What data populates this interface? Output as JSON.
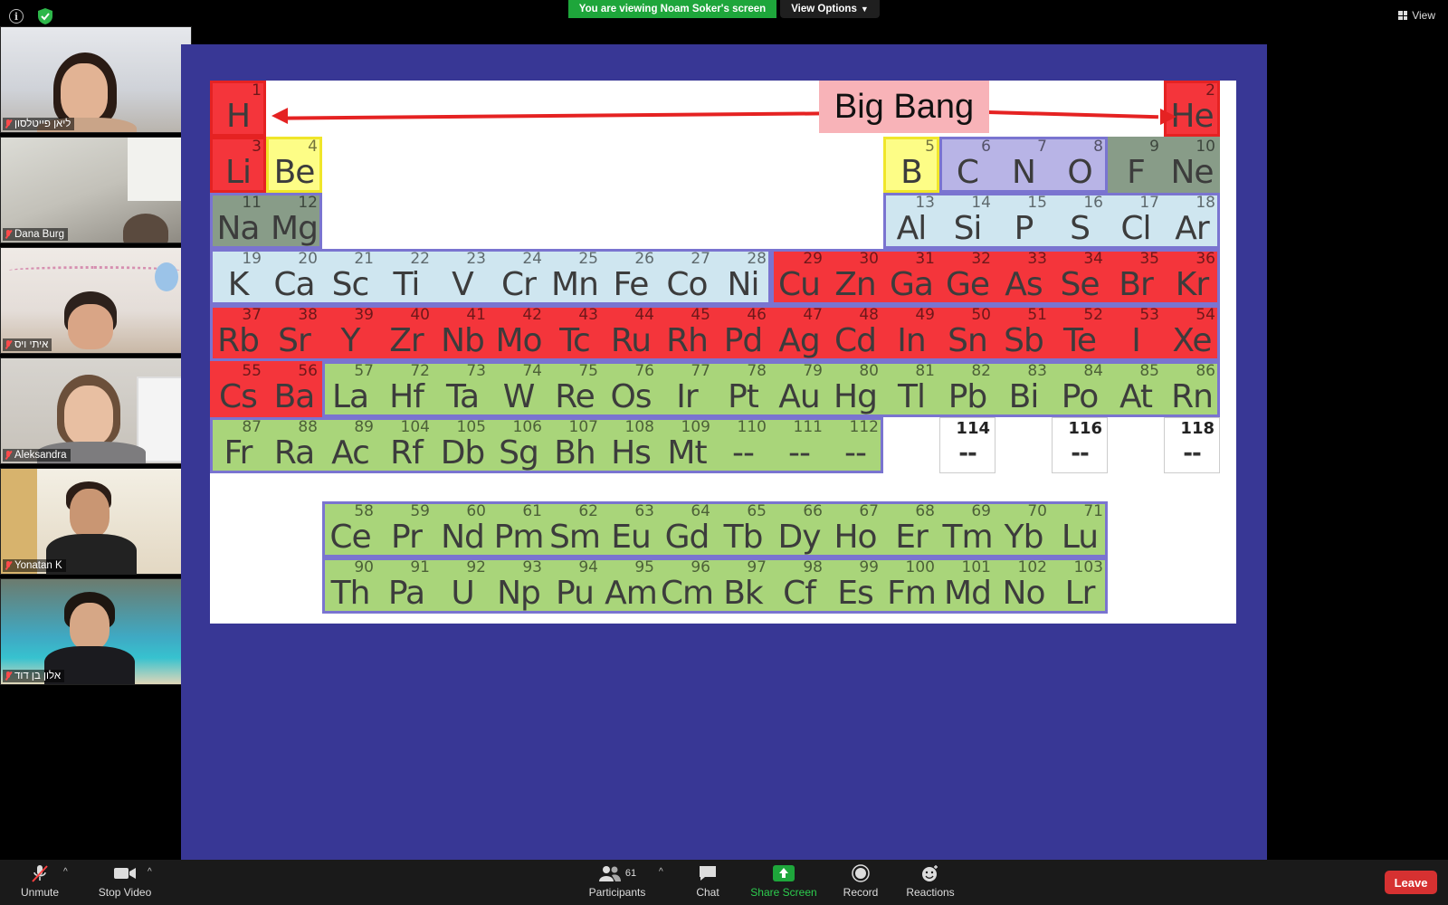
{
  "meeting": {
    "share_banner": "You are viewing Noam Soker's screen",
    "view_options": "View Options",
    "view_label": "View"
  },
  "participants": [
    {
      "name": "ליאן פייטלסון"
    },
    {
      "name": "Dana Burg"
    },
    {
      "name": "איתי ויס"
    },
    {
      "name": "Aleksandra"
    },
    {
      "name": "Yonatan K"
    },
    {
      "name": "אלון בן דוד"
    }
  ],
  "slide": {
    "title": "Big Bang",
    "colors": {
      "red": "#f4353b",
      "green": "#a9d57a",
      "light_blue": "#cfe6f0",
      "purple": "#b8b4e6",
      "gray_green": "#889c88",
      "yellow": "#fdfd86",
      "background": "#383795"
    },
    "elements": [
      {
        "n": "1",
        "s": "H",
        "c": "c-red"
      },
      {
        "n": "2",
        "s": "He",
        "c": "c-red"
      },
      {
        "n": "3",
        "s": "Li",
        "c": "c-red"
      },
      {
        "n": "4",
        "s": "Be",
        "c": "c-yellow"
      },
      {
        "n": "5",
        "s": "B",
        "c": "c-yellow"
      },
      {
        "n": "6",
        "s": "C",
        "c": "c-purple"
      },
      {
        "n": "7",
        "s": "N",
        "c": "c-purple"
      },
      {
        "n": "8",
        "s": "O",
        "c": "c-purple"
      },
      {
        "n": "9",
        "s": "F",
        "c": "c-dark"
      },
      {
        "n": "10",
        "s": "Ne",
        "c": "c-dark"
      },
      {
        "n": "11",
        "s": "Na",
        "c": "c-dark"
      },
      {
        "n": "12",
        "s": "Mg",
        "c": "c-dark"
      },
      {
        "n": "13",
        "s": "Al",
        "c": "c-blue"
      },
      {
        "n": "14",
        "s": "Si",
        "c": "c-blue"
      },
      {
        "n": "15",
        "s": "P",
        "c": "c-blue"
      },
      {
        "n": "16",
        "s": "S",
        "c": "c-blue"
      },
      {
        "n": "17",
        "s": "Cl",
        "c": "c-blue"
      },
      {
        "n": "18",
        "s": "Ar",
        "c": "c-blue"
      },
      {
        "n": "19",
        "s": "K",
        "c": "c-blue"
      },
      {
        "n": "20",
        "s": "Ca",
        "c": "c-blue"
      },
      {
        "n": "21",
        "s": "Sc",
        "c": "c-blue"
      },
      {
        "n": "22",
        "s": "Ti",
        "c": "c-blue"
      },
      {
        "n": "23",
        "s": "V",
        "c": "c-blue"
      },
      {
        "n": "24",
        "s": "Cr",
        "c": "c-blue"
      },
      {
        "n": "25",
        "s": "Mn",
        "c": "c-blue"
      },
      {
        "n": "26",
        "s": "Fe",
        "c": "c-blue"
      },
      {
        "n": "27",
        "s": "Co",
        "c": "c-blue"
      },
      {
        "n": "28",
        "s": "Ni",
        "c": "c-blue"
      },
      {
        "n": "29",
        "s": "Cu",
        "c": "c-red"
      },
      {
        "n": "30",
        "s": "Zn",
        "c": "c-red"
      },
      {
        "n": "31",
        "s": "Ga",
        "c": "c-red"
      },
      {
        "n": "32",
        "s": "Ge",
        "c": "c-red"
      },
      {
        "n": "33",
        "s": "As",
        "c": "c-red"
      },
      {
        "n": "34",
        "s": "Se",
        "c": "c-red"
      },
      {
        "n": "35",
        "s": "Br",
        "c": "c-red"
      },
      {
        "n": "36",
        "s": "Kr",
        "c": "c-red"
      },
      {
        "n": "37",
        "s": "Rb",
        "c": "c-red"
      },
      {
        "n": "38",
        "s": "Sr",
        "c": "c-red"
      },
      {
        "n": "39",
        "s": "Y",
        "c": "c-red"
      },
      {
        "n": "40",
        "s": "Zr",
        "c": "c-red"
      },
      {
        "n": "41",
        "s": "Nb",
        "c": "c-red"
      },
      {
        "n": "42",
        "s": "Mo",
        "c": "c-red"
      },
      {
        "n": "43",
        "s": "Tc",
        "c": "c-red"
      },
      {
        "n": "44",
        "s": "Ru",
        "c": "c-red"
      },
      {
        "n": "45",
        "s": "Rh",
        "c": "c-red"
      },
      {
        "n": "46",
        "s": "Pd",
        "c": "c-red"
      },
      {
        "n": "47",
        "s": "Ag",
        "c": "c-red"
      },
      {
        "n": "48",
        "s": "Cd",
        "c": "c-red"
      },
      {
        "n": "49",
        "s": "In",
        "c": "c-red"
      },
      {
        "n": "50",
        "s": "Sn",
        "c": "c-red"
      },
      {
        "n": "51",
        "s": "Sb",
        "c": "c-red"
      },
      {
        "n": "52",
        "s": "Te",
        "c": "c-red"
      },
      {
        "n": "53",
        "s": "I",
        "c": "c-red"
      },
      {
        "n": "54",
        "s": "Xe",
        "c": "c-red"
      },
      {
        "n": "55",
        "s": "Cs",
        "c": "c-red"
      },
      {
        "n": "56",
        "s": "Ba",
        "c": "c-red"
      },
      {
        "n": "57",
        "s": "La",
        "c": "c-green"
      },
      {
        "n": "72",
        "s": "Hf",
        "c": "c-green"
      },
      {
        "n": "73",
        "s": "Ta",
        "c": "c-green"
      },
      {
        "n": "74",
        "s": "W",
        "c": "c-green"
      },
      {
        "n": "75",
        "s": "Re",
        "c": "c-green"
      },
      {
        "n": "76",
        "s": "Os",
        "c": "c-green"
      },
      {
        "n": "77",
        "s": "Ir",
        "c": "c-green"
      },
      {
        "n": "78",
        "s": "Pt",
        "c": "c-green"
      },
      {
        "n": "79",
        "s": "Au",
        "c": "c-green"
      },
      {
        "n": "80",
        "s": "Hg",
        "c": "c-green"
      },
      {
        "n": "81",
        "s": "Tl",
        "c": "c-green"
      },
      {
        "n": "82",
        "s": "Pb",
        "c": "c-green"
      },
      {
        "n": "83",
        "s": "Bi",
        "c": "c-green"
      },
      {
        "n": "84",
        "s": "Po",
        "c": "c-green"
      },
      {
        "n": "85",
        "s": "At",
        "c": "c-green"
      },
      {
        "n": "86",
        "s": "Rn",
        "c": "c-green"
      },
      {
        "n": "87",
        "s": "Fr",
        "c": "c-green"
      },
      {
        "n": "88",
        "s": "Ra",
        "c": "c-green"
      },
      {
        "n": "89",
        "s": "Ac",
        "c": "c-green"
      },
      {
        "n": "104",
        "s": "Rf",
        "c": "c-green"
      },
      {
        "n": "105",
        "s": "Db",
        "c": "c-green"
      },
      {
        "n": "106",
        "s": "Sg",
        "c": "c-green"
      },
      {
        "n": "107",
        "s": "Bh",
        "c": "c-green"
      },
      {
        "n": "108",
        "s": "Hs",
        "c": "c-green"
      },
      {
        "n": "109",
        "s": "Mt",
        "c": "c-green"
      },
      {
        "n": "110",
        "s": "--",
        "c": "c-green"
      },
      {
        "n": "111",
        "s": "--",
        "c": "c-green"
      },
      {
        "n": "112",
        "s": "--",
        "c": "c-green"
      },
      {
        "n": "114",
        "s": "--",
        "c": "c-white"
      },
      {
        "n": "116",
        "s": "--",
        "c": "c-white"
      },
      {
        "n": "118",
        "s": "--",
        "c": "c-white"
      },
      {
        "n": "58",
        "s": "Ce",
        "c": "c-green"
      },
      {
        "n": "59",
        "s": "Pr",
        "c": "c-green"
      },
      {
        "n": "60",
        "s": "Nd",
        "c": "c-green"
      },
      {
        "n": "61",
        "s": "Pm",
        "c": "c-green"
      },
      {
        "n": "62",
        "s": "Sm",
        "c": "c-green"
      },
      {
        "n": "63",
        "s": "Eu",
        "c": "c-green"
      },
      {
        "n": "64",
        "s": "Gd",
        "c": "c-green"
      },
      {
        "n": "65",
        "s": "Tb",
        "c": "c-green"
      },
      {
        "n": "66",
        "s": "Dy",
        "c": "c-green"
      },
      {
        "n": "67",
        "s": "Ho",
        "c": "c-green"
      },
      {
        "n": "68",
        "s": "Er",
        "c": "c-green"
      },
      {
        "n": "69",
        "s": "Tm",
        "c": "c-green"
      },
      {
        "n": "70",
        "s": "Yb",
        "c": "c-green"
      },
      {
        "n": "71",
        "s": "Lu",
        "c": "c-green"
      },
      {
        "n": "90",
        "s": "Th",
        "c": "c-green"
      },
      {
        "n": "91",
        "s": "Pa",
        "c": "c-green"
      },
      {
        "n": "92",
        "s": "U",
        "c": "c-green"
      },
      {
        "n": "93",
        "s": "Np",
        "c": "c-green"
      },
      {
        "n": "94",
        "s": "Pu",
        "c": "c-green"
      },
      {
        "n": "95",
        "s": "Am",
        "c": "c-green"
      },
      {
        "n": "96",
        "s": "Cm",
        "c": "c-green"
      },
      {
        "n": "97",
        "s": "Bk",
        "c": "c-green"
      },
      {
        "n": "98",
        "s": "Cf",
        "c": "c-green"
      },
      {
        "n": "99",
        "s": "Es",
        "c": "c-green"
      },
      {
        "n": "100",
        "s": "Fm",
        "c": "c-green"
      },
      {
        "n": "101",
        "s": "Md",
        "c": "c-green"
      },
      {
        "n": "102",
        "s": "No",
        "c": "c-green"
      },
      {
        "n": "103",
        "s": "Lr",
        "c": "c-green"
      }
    ]
  },
  "toolbar": {
    "unmute": "Unmute",
    "stop_video": "Stop Video",
    "participants": "Participants",
    "participants_count": "61",
    "chat": "Chat",
    "share_screen": "Share Screen",
    "record": "Record",
    "reactions": "Reactions",
    "leave": "Leave",
    "share_color": "#1ea63b",
    "leave_color": "#d63131"
  }
}
